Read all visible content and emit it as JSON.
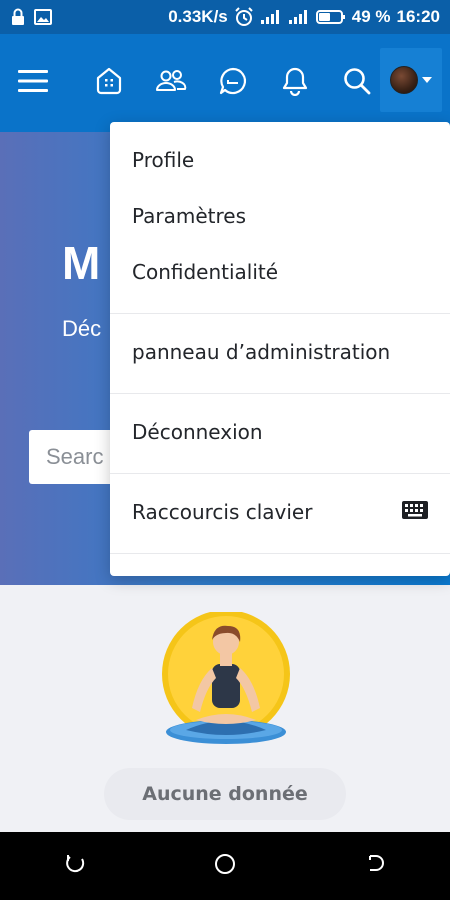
{
  "status_bar": {
    "network_speed": "0.33K/s",
    "battery": "49 %",
    "time": "16:20"
  },
  "app_bar": {
    "icons": [
      "hamburger-menu-icon",
      "home-icon",
      "friends-icon",
      "messages-icon",
      "notifications-icon",
      "search-icon"
    ]
  },
  "hero": {
    "title": "M",
    "subtitle": "Déc",
    "search_placeholder": "Searc"
  },
  "menu": {
    "items": [
      {
        "label": "Profile"
      },
      {
        "label": "Paramètres"
      },
      {
        "label": "Confidentialité"
      },
      {
        "label": "panneau d’administration"
      },
      {
        "label": "Déconnexion"
      },
      {
        "label": "Raccourcis clavier"
      }
    ]
  },
  "empty_state": {
    "label": "Aucune donnée"
  },
  "colors": {
    "status_bar": "#0b5fa8",
    "app_bar": "#0a73c9",
    "accent": "#f5c518"
  }
}
